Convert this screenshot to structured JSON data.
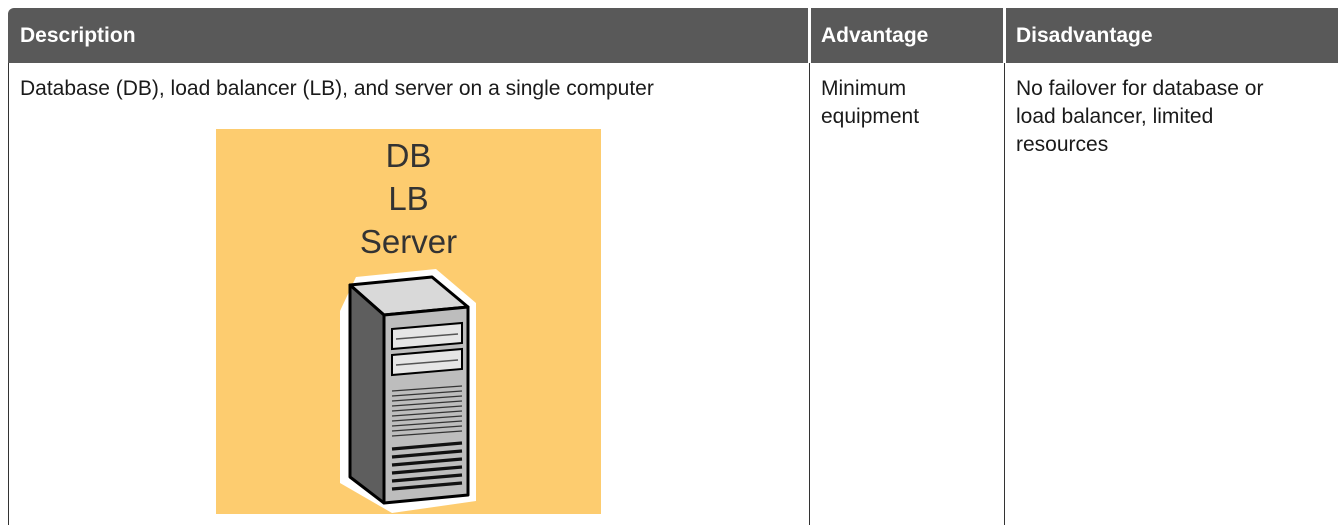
{
  "table": {
    "headers": {
      "description": "Description",
      "advantage": "Advantage",
      "disadvantage": "Disadvantage"
    },
    "rows": [
      {
        "description": "Database (DB), load balancer (LB), and server on a single computer",
        "advantage_lines": [
          "Minimum",
          "equipment"
        ],
        "disadvantage_lines": [
          "No failover for database or",
          "load balancer, limited",
          "resources"
        ],
        "figure": {
          "labels": [
            "DB",
            "LB",
            "Server"
          ],
          "icon": "server-tower-icon",
          "background_color": "#fdcc6f"
        }
      }
    ]
  },
  "colors": {
    "header_background": "#595959",
    "header_text": "#ffffff",
    "figure_background": "#fdcc6f"
  }
}
